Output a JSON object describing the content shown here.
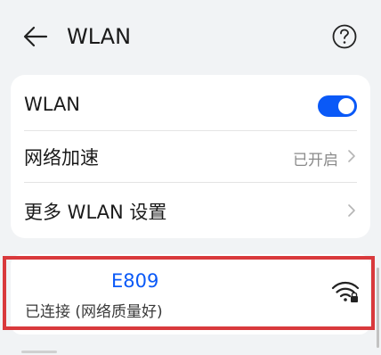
{
  "header": {
    "title": "WLAN",
    "back_icon": "arrow-left-icon",
    "help_icon": "question-circle-icon"
  },
  "settings": {
    "wlan": {
      "label": "WLAN",
      "enabled": true
    },
    "accelerate": {
      "label": "网络加速",
      "value": "已开启"
    },
    "more": {
      "label": "更多 WLAN 设置"
    }
  },
  "network": {
    "name": "E809",
    "status": "已连接 (网络质量好)",
    "signal_icon": "wifi-locked-icon"
  },
  "colors": {
    "accent": "#0a59f7",
    "highlight": "#d9393c",
    "background": "#f1f3f5"
  }
}
